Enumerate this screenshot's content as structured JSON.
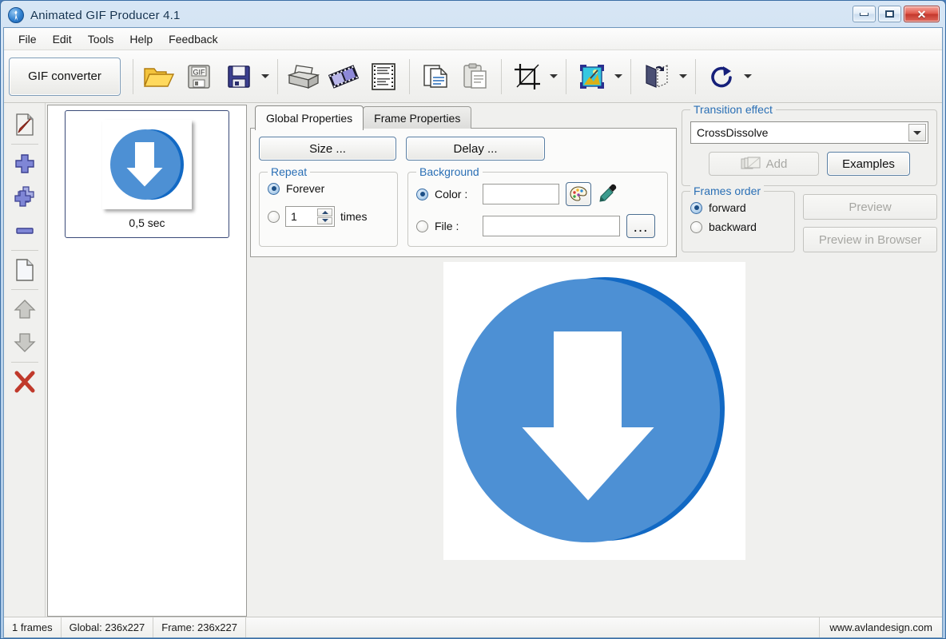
{
  "window": {
    "title": "Animated GIF Producer 4.1",
    "app_icon": "app-globe-icon",
    "minimize_label": "Minimize",
    "maximize_label": "Maximize",
    "close_label": "Close",
    "close_glyph": "✕"
  },
  "menu": {
    "items": [
      {
        "label": "File"
      },
      {
        "label": "Edit"
      },
      {
        "label": "Tools"
      },
      {
        "label": "Help"
      },
      {
        "label": "Feedback"
      }
    ]
  },
  "toolbar": {
    "gif_converter_label": "GIF converter",
    "buttons": [
      {
        "name": "open-folder-button",
        "icon": "open-folder-icon",
        "has_dropdown": false
      },
      {
        "name": "open-gif-button",
        "icon": "gif-diskette-icon",
        "has_dropdown": false
      },
      {
        "name": "save-button",
        "icon": "floppy-disk-icon",
        "has_dropdown": true
      },
      {
        "name": "print-button",
        "icon": "printer-icon",
        "has_dropdown": false
      },
      {
        "name": "filmstrip-button",
        "icon": "filmstrip-icon",
        "has_dropdown": false
      },
      {
        "name": "html-code-button",
        "icon": "document-lines-icon",
        "has_dropdown": false
      },
      {
        "name": "copy-button",
        "icon": "copy-pages-icon",
        "has_dropdown": false
      },
      {
        "name": "paste-button",
        "icon": "clipboard-icon",
        "has_dropdown": false
      },
      {
        "name": "crop-button",
        "icon": "crop-icon",
        "has_dropdown": true
      },
      {
        "name": "effects-button",
        "icon": "picture-wand-icon",
        "has_dropdown": true
      },
      {
        "name": "flip-button",
        "icon": "flip-mirror-icon",
        "has_dropdown": true
      },
      {
        "name": "rotate-button",
        "icon": "rotate-cw-icon",
        "has_dropdown": true
      }
    ]
  },
  "rail": {
    "buttons": [
      {
        "name": "edit-frame-button",
        "icon": "pencil-page-icon"
      },
      {
        "name": "add-frame-button",
        "icon": "plus-icon"
      },
      {
        "name": "add-multiple-frames-button",
        "icon": "multi-plus-icon"
      },
      {
        "name": "remove-frame-button",
        "icon": "minus-icon"
      },
      {
        "name": "new-blank-frame-button",
        "icon": "blank-page-icon"
      },
      {
        "name": "move-frame-up-button",
        "icon": "arrow-up-icon"
      },
      {
        "name": "move-frame-down-button",
        "icon": "arrow-down-icon"
      },
      {
        "name": "delete-all-button",
        "icon": "red-x-icon"
      }
    ]
  },
  "frames": {
    "list": [
      {
        "caption": "0,5 sec",
        "selected": true,
        "thumb_icon": "blue-download-arrow"
      }
    ]
  },
  "tabs": [
    {
      "label": "Global Properties",
      "active": true
    },
    {
      "label": "Frame Properties",
      "active": false
    }
  ],
  "global_properties": {
    "size_button": "Size ...",
    "delay_button": "Delay ...",
    "repeat": {
      "legend": "Repeat",
      "forever_label": "Forever",
      "forever_selected": true,
      "times_value": "1",
      "times_label": "times",
      "times_selected": false
    },
    "background": {
      "legend": "Background",
      "color_label": "Color :",
      "color_selected": true,
      "color_value": "",
      "color_swatch": "#ffffff",
      "palette_icon": "color-palette-icon",
      "eyedropper_icon": "eyedropper-icon",
      "file_label": "File :",
      "file_selected": false,
      "file_value": "",
      "browse_label": "..."
    }
  },
  "transition": {
    "legend": "Transition effect",
    "effect_value": "CrossDissolve",
    "add_label": "Add",
    "add_icon": "stacked-frames-icon",
    "add_disabled": true,
    "examples_label": "Examples"
  },
  "frames_order": {
    "legend": "Frames order",
    "forward_label": "forward",
    "backward_label": "backward",
    "selected": "forward"
  },
  "preview_buttons": {
    "preview_label": "Preview",
    "preview_disabled": true,
    "preview_browser_label": "Preview in Browser",
    "preview_browser_disabled": true
  },
  "preview": {
    "image_name": "blue-download-arrow-image"
  },
  "statusbar": {
    "frames": "1 frames",
    "global_size": "Global: 236x227",
    "frame_size": "Frame: 236x227",
    "website": "www.avlandesign.com"
  },
  "colors": {
    "accent_blue": "#2a6fb5",
    "title_gradient_top": "#d7e6f5",
    "title_gradient_bottom": "#a9c7e6",
    "arrow_front": "#4d90d4",
    "arrow_back": "#1269c4",
    "close_red": "#c3372c"
  }
}
